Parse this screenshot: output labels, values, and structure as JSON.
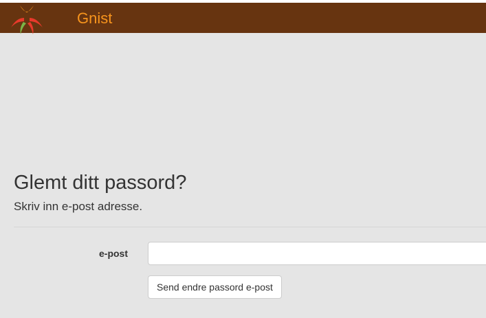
{
  "header": {
    "brand": "Gnist",
    "logo_icon": "gnist-spark-logo-icon",
    "background_color": "#673410",
    "brand_color": "#f7941d"
  },
  "main": {
    "title": "Glemt ditt passord?",
    "subtitle": "Skriv inn e-post adresse.",
    "form": {
      "email_label": "e-post",
      "email_value": "",
      "send_button_label": "Send endre passord e-post"
    }
  }
}
